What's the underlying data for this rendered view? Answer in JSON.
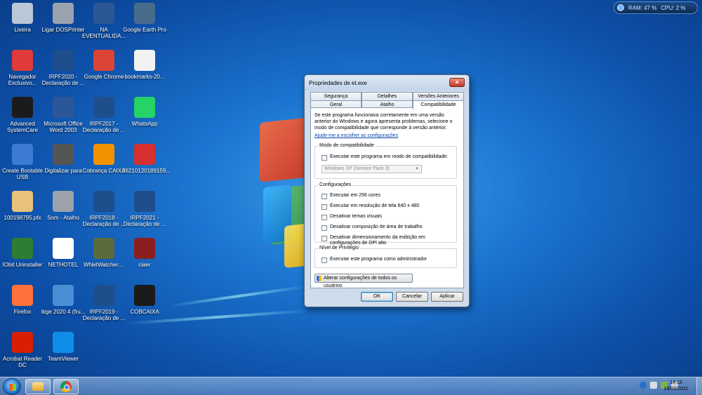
{
  "gadget": {
    "ram_label": "RAM: 47 %",
    "cpu_label": "CPU: 2 %"
  },
  "desktop_icons": [
    {
      "label": "Lixeira",
      "icon": "recycle-bin-icon",
      "color": "#b9c7d6"
    },
    {
      "label": "Ligar DOSPrinter",
      "icon": "printer-icon",
      "color": "#9aa3ad"
    },
    {
      "label": "NA EVENTUALIDA...",
      "icon": "word-doc-icon",
      "color": "#2b5797"
    },
    {
      "label": "Google Earth Pro",
      "icon": "google-earth-icon",
      "color": "#4a6c8c"
    },
    {
      "label": "Navegador Exclusivo...",
      "icon": "navegador-icon",
      "color": "#e03a3a"
    },
    {
      "label": "IRPF2020 - Declaração de ...",
      "icon": "irpf-icon",
      "color": "#1f4e8c"
    },
    {
      "label": "Google Chrome",
      "icon": "chrome-icon",
      "color": "#db4437"
    },
    {
      "label": "bookmarks-20...",
      "icon": "file-icon",
      "color": "#f2f2f2"
    },
    {
      "label": "Advanced SystemCare",
      "icon": "systemcare-icon",
      "color": "#1b1b1b"
    },
    {
      "label": "Microsoft Office Word 2003",
      "icon": "word-icon",
      "color": "#2b579a"
    },
    {
      "label": "IRPF2017 - Declaração de ...",
      "icon": "irpf-icon",
      "color": "#1f4e8c"
    },
    {
      "label": "WhatsApp",
      "icon": "whatsapp-icon",
      "color": "#25d366"
    },
    {
      "label": "Create Bootable USB",
      "icon": "usb-icon",
      "color": "#3b7bd6"
    },
    {
      "label": "Digitalizar para",
      "icon": "scanner-icon",
      "color": "#555555"
    },
    {
      "label": "Cobrança CAIXA",
      "icon": "caixa-icon",
      "color": "#f39200"
    },
    {
      "label": "36210120189159...",
      "icon": "pdf-icon",
      "color": "#d63031"
    },
    {
      "label": "100198795.pfx",
      "icon": "certificate-icon",
      "color": "#e8c27a"
    },
    {
      "label": "Som - Atalho",
      "icon": "speaker-icon",
      "color": "#9aa3ad"
    },
    {
      "label": "IRPF2018 - Declaração de ...",
      "icon": "irpf-icon",
      "color": "#1f4e8c"
    },
    {
      "label": "IRPF2021 - Declaração de ...",
      "icon": "irpf-icon",
      "color": "#1f4e8c"
    },
    {
      "label": "IObit Uninstaller",
      "icon": "iobit-icon",
      "color": "#2e7d32"
    },
    {
      "label": "NETHOTEL",
      "icon": "nethotel-icon",
      "color": "#ffffff"
    },
    {
      "label": "WNetWatcher....",
      "icon": "eye-icon",
      "color": "#5b6b3a"
    },
    {
      "label": "ciaer",
      "icon": "ciaer-icon",
      "color": "#8b1e1e"
    },
    {
      "label": "Firefox",
      "icon": "firefox-icon",
      "color": "#ff7139"
    },
    {
      "label": "ibge 2020 4 (fru...",
      "icon": "ibge-icon",
      "color": "#4a8fd6"
    },
    {
      "label": "IRPF2019 - Declaração de ...",
      "icon": "irpf-icon",
      "color": "#1f4e8c"
    },
    {
      "label": "COBCAIXA",
      "icon": "cobcaixa-icon",
      "color": "#1a1a1a"
    },
    {
      "label": "Acrobat Reader DC",
      "icon": "acrobat-icon",
      "color": "#d81e05"
    },
    {
      "label": "TeamViewer",
      "icon": "teamviewer-icon",
      "color": "#0e8ee9"
    }
  ],
  "dialog": {
    "title": "Propriedades de et.exe",
    "close_label": "×",
    "tabs_top": [
      "Segurança",
      "Detalhes",
      "Versões Anteriores"
    ],
    "tabs_bottom": [
      "Geral",
      "Atalho",
      "Compatibilidade"
    ],
    "intro": "Se este programa funcionava corretamente em uma versão anterior do Windows e agora apresenta problemas, selecione o modo de compatibilidade que corresponde à versão anterior.",
    "help_link": "Ajude-me a escolher as configurações",
    "compat_group": {
      "title": "Modo de compatibilidade",
      "checkbox": "Executar este programa em modo de compatibilidade:",
      "select_value": "Windows XP (Service Pack 3)"
    },
    "settings_group": {
      "title": "Configurações",
      "items": [
        "Executar em 256 cores",
        "Executar em resolução de tela 640 x 480",
        "Desativar temas visuais",
        "Desativar composição de área de trabalho",
        "Desativar dimensionamento da exibição em configurações de DPI alto"
      ]
    },
    "privilege_group": {
      "title": "Nível de Privilégio",
      "checkbox": "Executar este programa como administrador"
    },
    "all_users_button": "Alterar configurações de todos os usuários",
    "ok": "OK",
    "cancel": "Cancelar",
    "apply": "Aplicar"
  },
  "taskbar": {
    "time": "14:13",
    "date": "16/03/2021"
  }
}
